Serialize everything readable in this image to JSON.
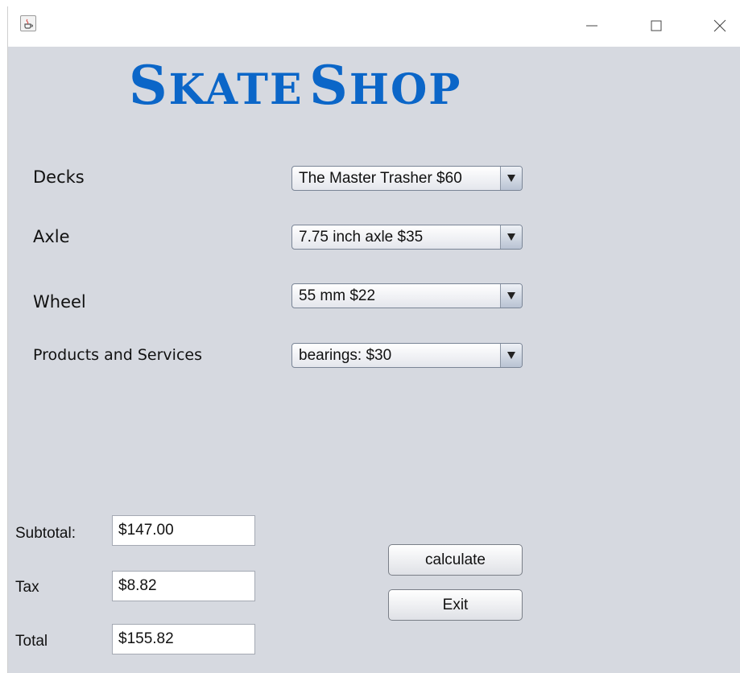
{
  "window": {
    "icon": "java-cup-icon",
    "controls": [
      "minimize-icon",
      "maximize-icon",
      "close-icon"
    ]
  },
  "title": {
    "first_cap": "S",
    "first_rest": "KATE",
    "second_cap": "S",
    "second_rest": "HOP",
    "color": "#0b66c8"
  },
  "form": {
    "decks": {
      "label": "Decks",
      "selected": "The Master Trasher $60"
    },
    "axle": {
      "label": "Axle",
      "selected": "7.75 inch axle $35"
    },
    "wheel": {
      "label": "Wheel",
      "selected": "55 mm $22"
    },
    "products": {
      "label": "Products and Services",
      "selected": "bearings: $30"
    }
  },
  "totals": {
    "subtotal": {
      "label": "Subtotal:",
      "value": "$147.00"
    },
    "tax": {
      "label": "Tax",
      "value": "$8.82"
    },
    "total": {
      "label": "Total",
      "value": "$155.82"
    }
  },
  "buttons": {
    "calculate": "calculate",
    "exit": "Exit"
  },
  "colors": {
    "background": "#d6d9e0",
    "titlebar": "#ffffff"
  }
}
